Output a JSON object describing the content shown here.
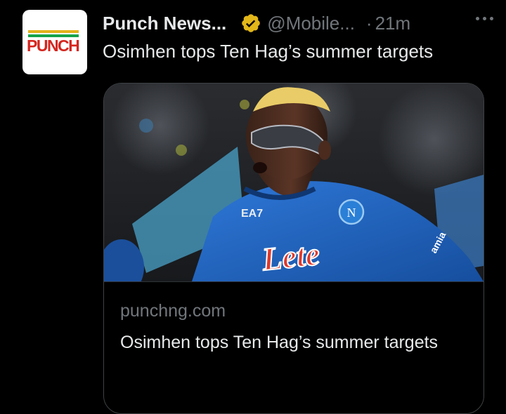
{
  "post": {
    "author_name": "Punch News...",
    "author_handle": "@Mobile...",
    "separator": "·",
    "time": "21m",
    "text": "Osimhen tops Ten Hag’s summer targets",
    "avatar_logo_text": "PUNCH",
    "verified_icon": "verified-badge-icon",
    "more_icon": "more-options-icon"
  },
  "card": {
    "domain": "punchng.com",
    "title": "Osimhen tops Ten Hag’s summer targets",
    "image_jersey_text": "Lete",
    "image_kit_brand": "EA7",
    "image_sleeve_text": "amia"
  },
  "colors": {
    "background": "#000000",
    "primary_text": "#e7e9ea",
    "secondary_text": "#71767b",
    "verified_gold": "#e2b719",
    "card_border": "#3e4144",
    "jersey_blue": "#1f62c4",
    "sponsor_red": "#e0382c"
  }
}
